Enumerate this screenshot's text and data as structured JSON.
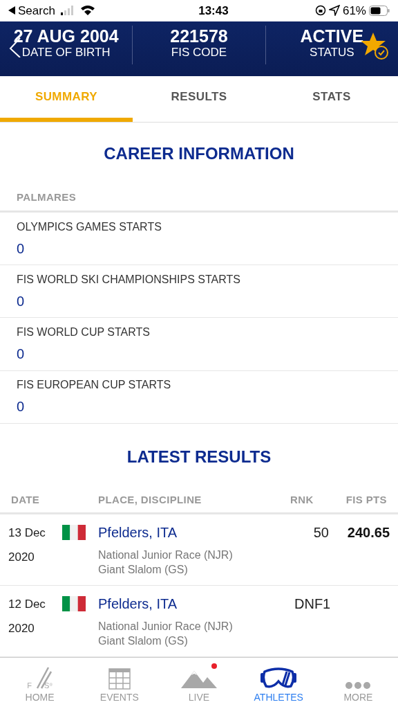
{
  "status_bar": {
    "back_label": "Search",
    "time": "13:43",
    "battery": "61%"
  },
  "header": {
    "stats": [
      {
        "value": "27 AUG 2004",
        "label": "DATE OF BIRTH"
      },
      {
        "value": "221578",
        "label": "FIS CODE"
      },
      {
        "value": "ACTIVE",
        "label": "STATUS"
      }
    ]
  },
  "tabs": [
    {
      "label": "SUMMARY",
      "selected": true
    },
    {
      "label": "RESULTS",
      "selected": false
    },
    {
      "label": "STATS",
      "selected": false
    }
  ],
  "career": {
    "title": "CAREER INFORMATION",
    "section": "PALMARES",
    "items": [
      {
        "label": "OLYMPICS GAMES STARTS",
        "value": "0"
      },
      {
        "label": "FIS WORLD SKI CHAMPIONSHIPS STARTS",
        "value": "0"
      },
      {
        "label": "FIS WORLD CUP STARTS",
        "value": "0"
      },
      {
        "label": "FIS EUROPEAN CUP STARTS",
        "value": "0"
      }
    ]
  },
  "latest_results": {
    "title": "LATEST RESULTS",
    "columns": [
      "DATE",
      "PLACE, DISCIPLINE",
      "RNK",
      "FIS PTS"
    ],
    "rows": [
      {
        "date": "13 Dec",
        "year": "2020",
        "place": "Pfelders, ITA",
        "category": "National Junior Race (NJR)",
        "discipline": "Giant Slalom (GS)",
        "rank": "50",
        "points": "240.65"
      },
      {
        "date": "12 Dec",
        "year": "2020",
        "place": "Pfelders, ITA",
        "category": "National Junior Race (NJR)",
        "discipline": "Giant Slalom (GS)",
        "rank": "DNF1"
      }
    ]
  },
  "tab_bar": {
    "logo": [
      "F",
      "S",
      "®"
    ],
    "items": [
      {
        "kind": "home",
        "label": "HOME",
        "selected": false,
        "badge": false
      },
      {
        "kind": "events",
        "label": "EVENTS",
        "selected": false,
        "badge": false
      },
      {
        "kind": "live",
        "label": "LIVE",
        "selected": false,
        "badge": true
      },
      {
        "kind": "athletes",
        "label": "ATHLETES",
        "selected": true,
        "badge": false
      },
      {
        "kind": "more",
        "label": "MORE",
        "selected": false,
        "badge": false
      }
    ]
  }
}
